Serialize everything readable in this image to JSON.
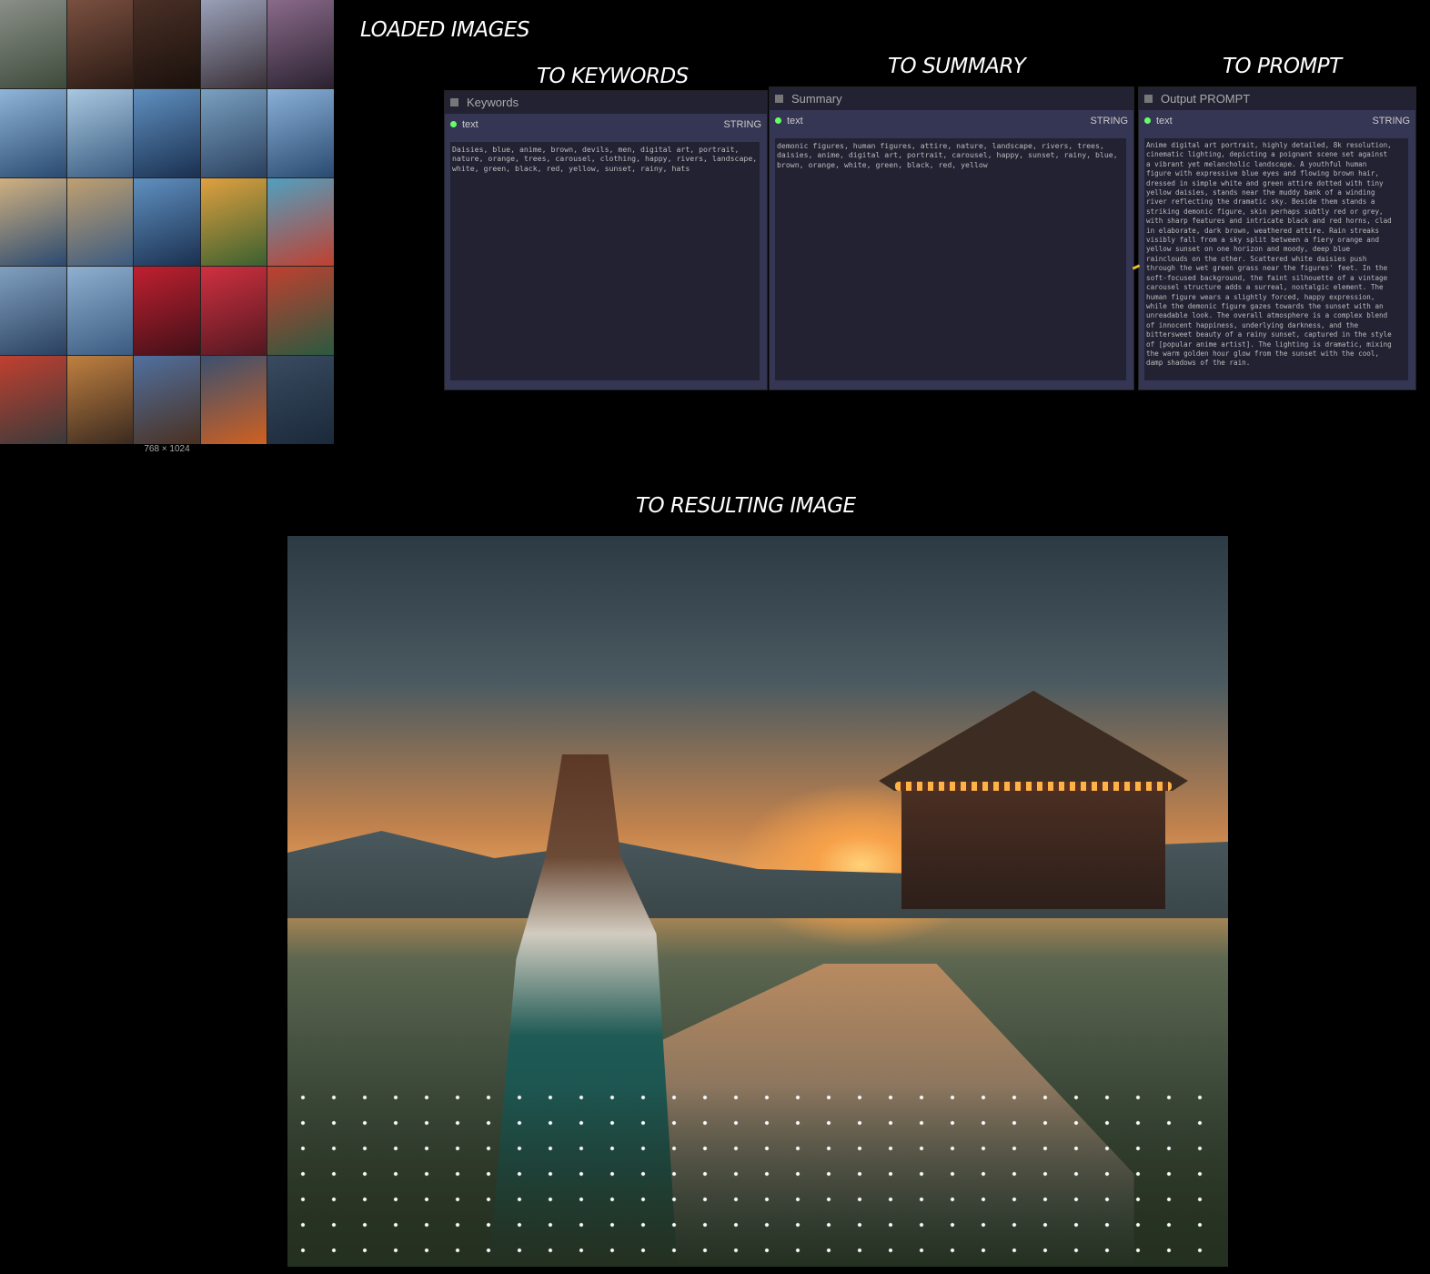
{
  "headings": {
    "loaded_images": "LOADED IMAGES",
    "to_keywords": "TO KEYWORDS",
    "to_summary": "TO SUMMARY",
    "to_prompt": "TO PROMPT",
    "to_resulting_image": "TO RESULTING IMAGE"
  },
  "image_batch": {
    "dimensions": "768 × 1024",
    "count": 25
  },
  "nodes": {
    "keywords": {
      "title": "Keywords",
      "output_name": "text",
      "output_type": "STRING",
      "value": "Daisies, blue, anime, brown, devils, men, digital art, portrait,\nnature, orange, trees, carousel, clothing, happy, rivers, landscape,\nwhite, green, black, red, yellow, sunset, rainy, hats"
    },
    "summary": {
      "title": "Summary",
      "output_name": "text",
      "output_type": "STRING",
      "value": "demonic figures, human figures, attire, nature, landscape, rivers, trees,\ndaisies, anime, digital art, portrait, carousel, happy, sunset, rainy, blue,\nbrown, orange, white, green, black, red, yellow"
    },
    "prompt": {
      "title": "Output PROMPT",
      "output_name": "text",
      "output_type": "STRING",
      "value": "Anime digital art portrait, highly detailed, 8k resolution,\ncinematic lighting, depicting a poignant scene set against\na vibrant yet melancholic landscape. A youthful human\nfigure with expressive blue eyes and flowing brown hair,\ndressed in simple white and green attire dotted with tiny\nyellow daisies, stands near the muddy bank of a winding\nriver reflecting the dramatic sky. Beside them stands a\nstriking demonic figure, skin perhaps subtly red or grey,\nwith sharp features and intricate black and red horns, clad\nin elaborate, dark brown, weathered attire. Rain streaks\nvisibly fall from a sky split between a fiery orange and\nyellow sunset on one horizon and moody, deep blue\nrainclouds on the other. Scattered white daisies push\nthrough the wet green grass near the figures' feet. In the\nsoft-focused background, the faint silhouette of a vintage\ncarousel structure adds a surreal, nostalgic element. The\nhuman figure wears a slightly forced, happy expression,\nwhile the demonic figure gazes towards the sunset with an\nunreadable look. The overall atmosphere is a complex blend\nof innocent happiness, underlying darkness, and the\nbittersweet beauty of a rainy sunset, captured in the style\nof [popular anime artist]. The lighting is dramatic, mixing\nthe warm golden hour glow from the sunset with the cool,\ndamp shadows of the rain."
    }
  },
  "colors": {
    "node_body": "#353554",
    "node_header": "#222233",
    "output_dot": "#66ff66",
    "link": "#e8c230"
  }
}
